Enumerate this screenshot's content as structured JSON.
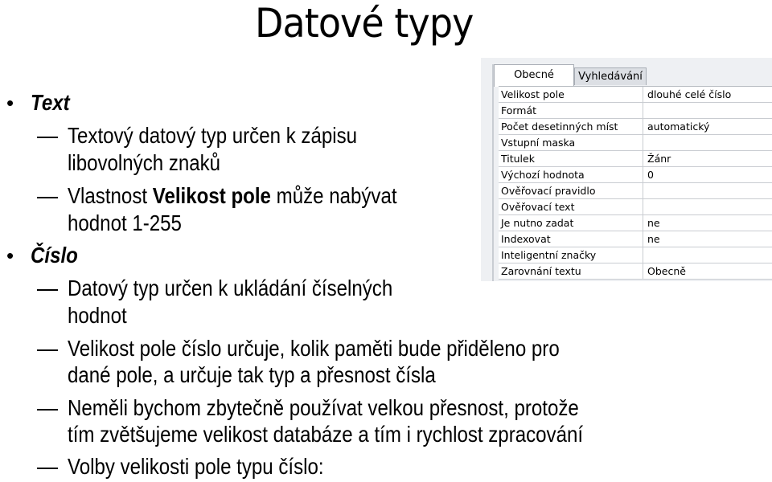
{
  "slide": {
    "title": "Datové typy",
    "sections": [
      {
        "heading": "Text",
        "items": [
          {
            "lines": [
              "Textový datový typ určen k zápisu",
              "libovolných znaků"
            ]
          },
          {
            "prefix": "Vlastnost ",
            "bold": "Velikost pole",
            "suffix": " může nabývat",
            "line2": "hodnot 1-255"
          }
        ]
      },
      {
        "heading": "Číslo",
        "items": [
          {
            "lines": [
              "Datový typ určen k ukládání číselných",
              "hodnot"
            ]
          },
          {
            "lines": [
              "Velikost pole číslo určuje, kolik paměti bude přiděleno pro",
              "dané pole, a určuje tak typ a přesnost čísla"
            ]
          },
          {
            "lines": [
              "Neměli bychom zbytečně používat velkou přesnost, protože",
              "tím zvětšujeme velikost databáze a tím i rychlost zpracování"
            ]
          },
          {
            "lines": [
              "Volby velikosti pole typu číslo:"
            ]
          }
        ]
      }
    ]
  },
  "dialog": {
    "tabs": [
      {
        "label": "Obecné",
        "active": true
      },
      {
        "label": "Vyhledávání",
        "active": false
      }
    ],
    "properties": [
      {
        "name": "Velikost pole",
        "value": "dlouhé celé číslo"
      },
      {
        "name": "Formát",
        "value": ""
      },
      {
        "name": "Počet desetinných míst",
        "value": "automatický"
      },
      {
        "name": "Vstupní maska",
        "value": ""
      },
      {
        "name": "Titulek",
        "value": "Žánr"
      },
      {
        "name": "Výchozí hodnota",
        "value": "0"
      },
      {
        "name": "Ověřovací pravidlo",
        "value": ""
      },
      {
        "name": "Ověřovací text",
        "value": ""
      },
      {
        "name": "Je nutno zadat",
        "value": "ne"
      },
      {
        "name": "Indexovat",
        "value": "ne"
      },
      {
        "name": "Inteligentní značky",
        "value": ""
      },
      {
        "name": "Zarovnání textu",
        "value": "Obecně"
      }
    ]
  }
}
